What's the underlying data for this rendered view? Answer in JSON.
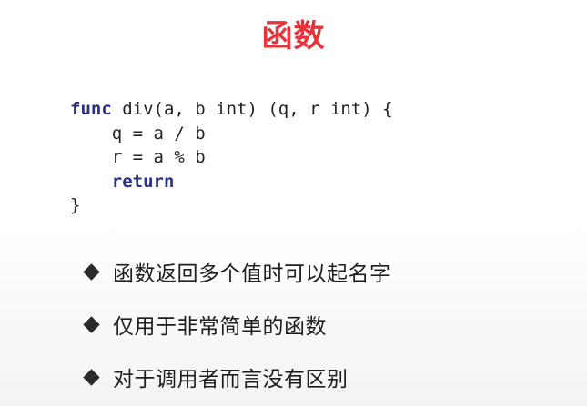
{
  "slide": {
    "title": "函数",
    "code": {
      "line1": {
        "keyword": "func",
        "rest": " div(a, b int) (q, r int) {"
      },
      "line2": "    q = a / b",
      "line3": "    r = a % b",
      "line4": {
        "indent": "    ",
        "keyword": "return"
      },
      "line5": "}"
    },
    "bullets": [
      "函数返回多个值时可以起名字",
      "仅用于非常简单的函数",
      "对于调用者而言没有区别"
    ]
  },
  "colors": {
    "title": "#e8333a",
    "keyword": "#2b2f8a",
    "text": "#222222"
  }
}
